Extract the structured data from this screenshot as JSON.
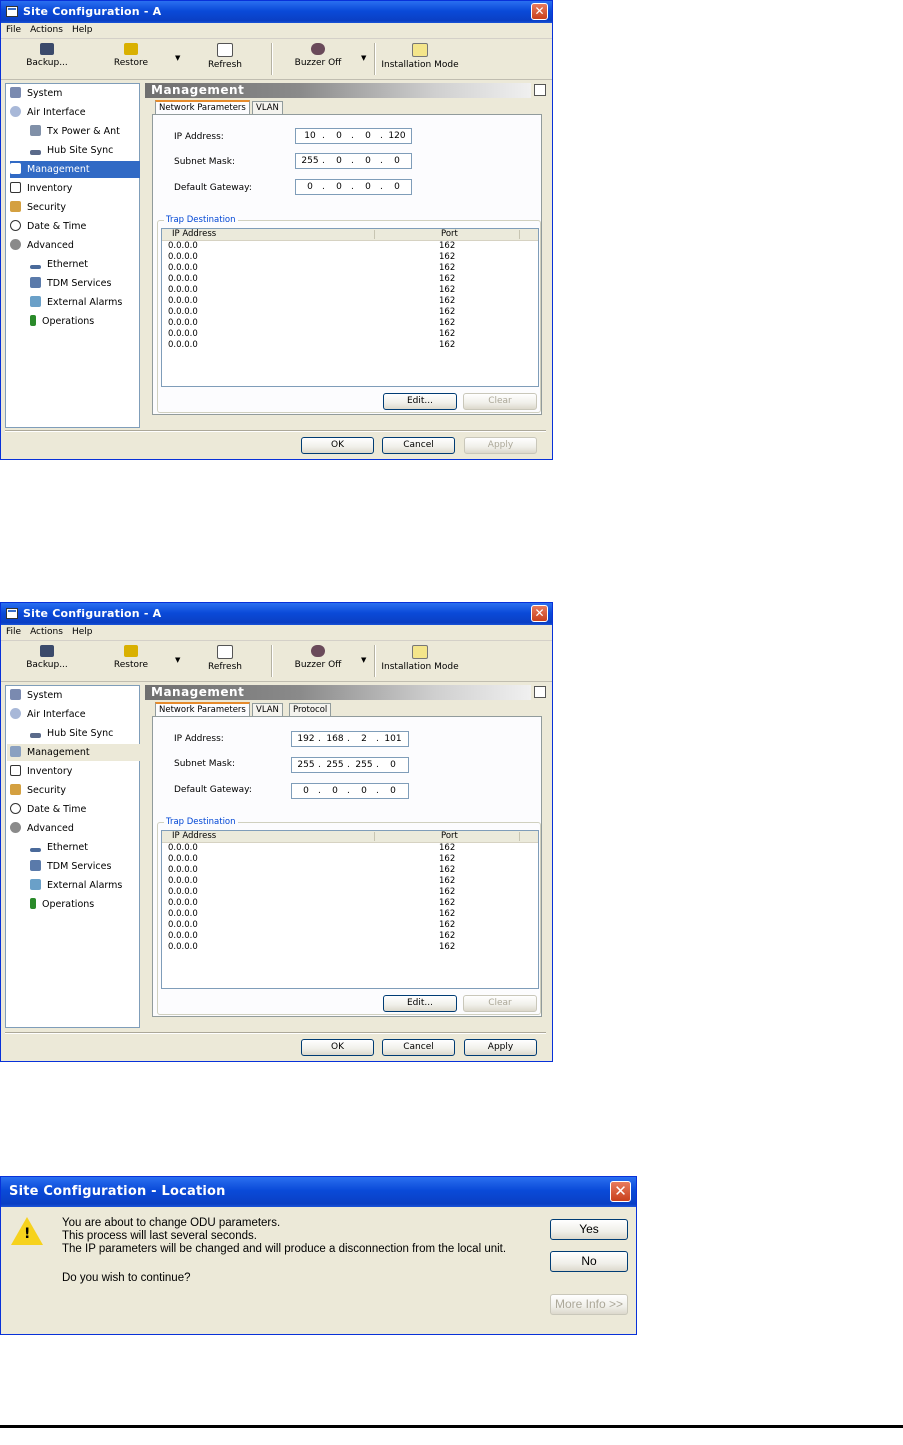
{
  "window1": {
    "title": "Site Configuration - A",
    "menu": [
      "File",
      "Actions",
      "Help"
    ],
    "toolbar": [
      "Backup...",
      "Restore",
      "Refresh",
      "Buzzer Off",
      "Installation Mode"
    ],
    "sidebar": [
      "System",
      "Air Interface",
      "Tx Power & Ant",
      "Hub Site Sync",
      "Management",
      "Inventory",
      "Security",
      "Date & Time",
      "Advanced",
      "Ethernet",
      "TDM Services",
      "External Alarms",
      "Operations"
    ],
    "section_title": "Management",
    "tabs": [
      "Network Parameters",
      "VLAN"
    ],
    "ip_label": "IP Address:",
    "subnet_label": "Subnet Mask:",
    "gateway_label": "Default Gateway:",
    "ip": [
      "10",
      "0",
      "0",
      "120"
    ],
    "subnet": [
      "255",
      "0",
      "0",
      "0"
    ],
    "gateway": [
      "0",
      "0",
      "0",
      "0"
    ],
    "trap_label": "Trap Destination",
    "col_ip": "IP Address",
    "col_port": "Port",
    "trap_rows": [
      {
        "ip": "0.0.0.0",
        "port": "162"
      },
      {
        "ip": "0.0.0.0",
        "port": "162"
      },
      {
        "ip": "0.0.0.0",
        "port": "162"
      },
      {
        "ip": "0.0.0.0",
        "port": "162"
      },
      {
        "ip": "0.0.0.0",
        "port": "162"
      },
      {
        "ip": "0.0.0.0",
        "port": "162"
      },
      {
        "ip": "0.0.0.0",
        "port": "162"
      },
      {
        "ip": "0.0.0.0",
        "port": "162"
      },
      {
        "ip": "0.0.0.0",
        "port": "162"
      },
      {
        "ip": "0.0.0.0",
        "port": "162"
      }
    ],
    "edit": "Edit...",
    "clear": "Clear",
    "ok": "OK",
    "cancel": "Cancel",
    "apply": "Apply"
  },
  "window2": {
    "title": "Site Configuration - A",
    "menu": [
      "File",
      "Actions",
      "Help"
    ],
    "toolbar": [
      "Backup...",
      "Restore",
      "Refresh",
      "Buzzer Off",
      "Installation Mode"
    ],
    "sidebar": [
      "System",
      "Air Interface",
      "Hub Site Sync",
      "Management",
      "Inventory",
      "Security",
      "Date & Time",
      "Advanced",
      "Ethernet",
      "TDM Services",
      "External Alarms",
      "Operations"
    ],
    "section_title": "Management",
    "tabs": [
      "Network Parameters",
      "VLAN",
      "Protocol"
    ],
    "ip_label": "IP Address:",
    "subnet_label": "Subnet Mask:",
    "gateway_label": "Default Gateway:",
    "ip": [
      "192",
      "168",
      "2",
      "101"
    ],
    "subnet": [
      "255",
      "255",
      "255",
      "0"
    ],
    "gateway": [
      "0",
      "0",
      "0",
      "0"
    ],
    "trap_label": "Trap Destination",
    "col_ip": "IP Address",
    "col_port": "Port",
    "trap_rows": [
      {
        "ip": "0.0.0.0",
        "port": "162"
      },
      {
        "ip": "0.0.0.0",
        "port": "162"
      },
      {
        "ip": "0.0.0.0",
        "port": "162"
      },
      {
        "ip": "0.0.0.0",
        "port": "162"
      },
      {
        "ip": "0.0.0.0",
        "port": "162"
      },
      {
        "ip": "0.0.0.0",
        "port": "162"
      },
      {
        "ip": "0.0.0.0",
        "port": "162"
      },
      {
        "ip": "0.0.0.0",
        "port": "162"
      },
      {
        "ip": "0.0.0.0",
        "port": "162"
      },
      {
        "ip": "0.0.0.0",
        "port": "162"
      }
    ],
    "edit": "Edit...",
    "clear": "Clear",
    "ok": "OK",
    "cancel": "Cancel",
    "apply": "Apply"
  },
  "dialog": {
    "title": "Site Configuration - Location",
    "lines": [
      "You are about to change ODU parameters.",
      "This process will last several seconds.",
      "The IP parameters will be changed and will produce a disconnection from the local unit.",
      "Do you wish to continue?"
    ],
    "yes": "Yes",
    "no": "No",
    "more_info": "More Info >>"
  },
  "colors": {
    "title_blue": "#0a4ad8",
    "selection": "#316ac5",
    "xp_face": "#ece9d8",
    "close_red": "#c9401c"
  },
  "icons": [
    "backup-icon",
    "restore-icon",
    "refresh-icon",
    "buzzer-icon",
    "installation-mode-icon",
    "warning-icon",
    "close-icon"
  ]
}
